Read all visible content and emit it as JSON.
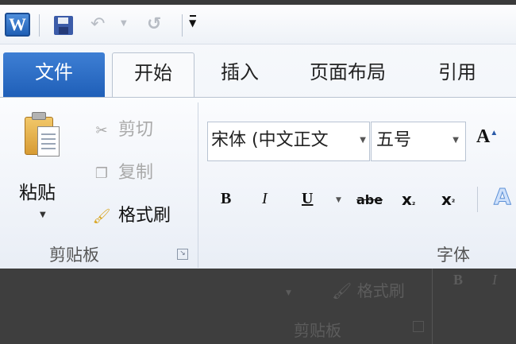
{
  "quick_access": {
    "app_icon": "W",
    "icons": [
      "word-app-icon",
      "save-icon",
      "undo-icon",
      "redo-icon",
      "customize-dropdown-icon"
    ]
  },
  "tabs": [
    {
      "label": "文件"
    },
    {
      "label": "开始"
    },
    {
      "label": "插入"
    },
    {
      "label": "页面布局"
    },
    {
      "label": "引用"
    }
  ],
  "clipboard": {
    "paste_label": "粘贴",
    "cut_label": "剪切",
    "copy_label": "复制",
    "format_painter_label": "格式刷",
    "group_label": "剪贴板"
  },
  "font": {
    "font_name": "宋体 (中文正文",
    "font_size": "五号",
    "grow_glyph": "A",
    "bold": "B",
    "italic": "I",
    "underline": "U",
    "strikethrough": "abe",
    "subscript": "x",
    "superscript": "x",
    "text_effect": "A",
    "group_label": "字体"
  },
  "background_dup": {
    "painter_label": "格式刷",
    "group_label": "剪贴板",
    "bold": "B",
    "italic": "I"
  },
  "colors": {
    "file_tab": "#2a6ac4",
    "ribbon_bg": "#eef2f8"
  }
}
